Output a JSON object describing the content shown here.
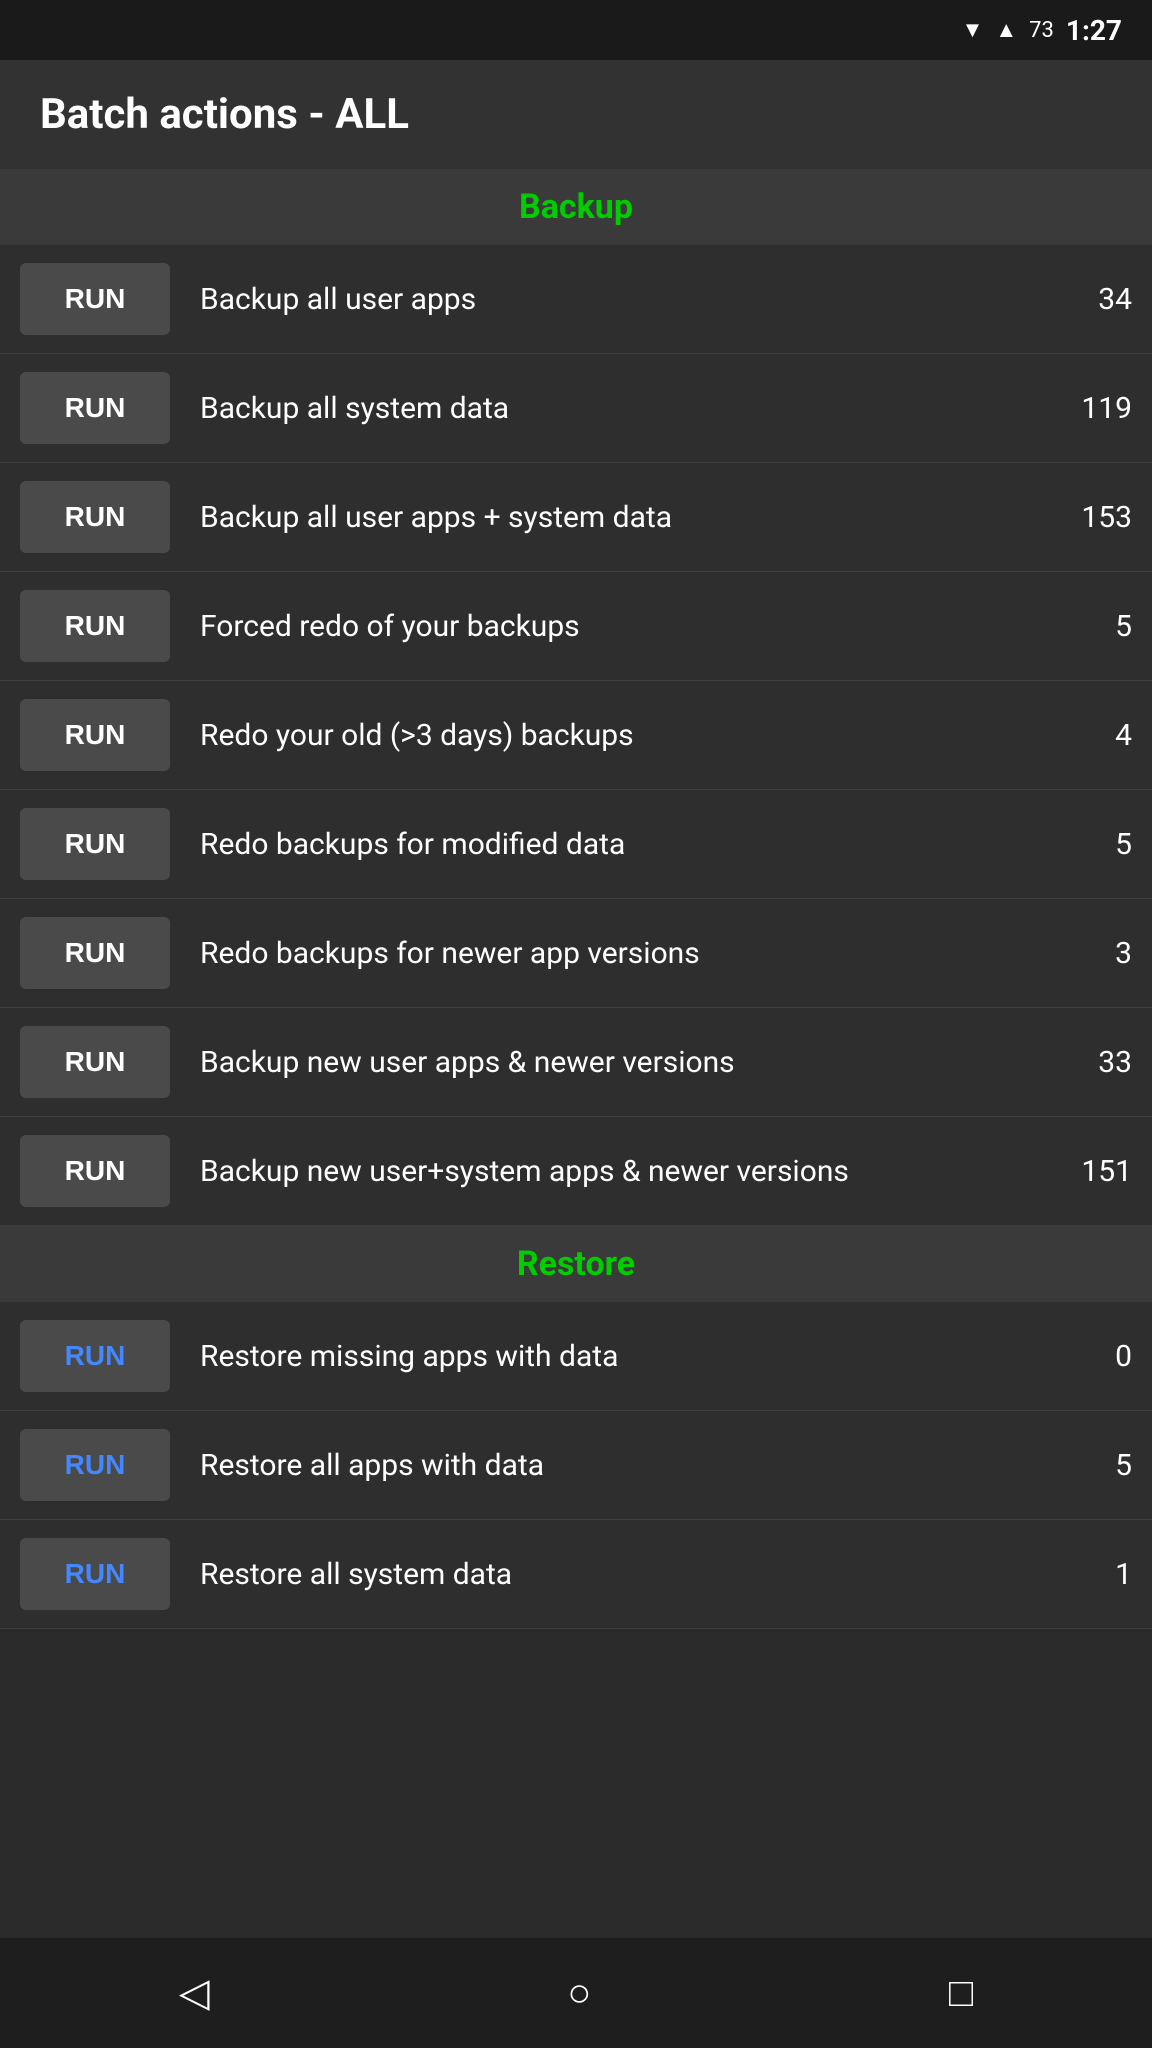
{
  "statusBar": {
    "time": "1:27",
    "batteryLevel": "73"
  },
  "header": {
    "title": "Batch actions - ALL"
  },
  "sections": [
    {
      "id": "backup",
      "label": "Backup",
      "color": "green",
      "items": [
        {
          "id": "backup-user-apps",
          "label": "Backup all user apps",
          "count": "34",
          "buttonColor": "default"
        },
        {
          "id": "backup-system-data",
          "label": "Backup all system data",
          "count": "119",
          "buttonColor": "default"
        },
        {
          "id": "backup-user-system",
          "label": "Backup all user apps + system data",
          "count": "153",
          "buttonColor": "default"
        },
        {
          "id": "forced-redo",
          "label": "Forced redo of your backups",
          "count": "5",
          "buttonColor": "default"
        },
        {
          "id": "redo-old",
          "label": "Redo your old (>3 days) backups",
          "count": "4",
          "buttonColor": "default"
        },
        {
          "id": "redo-modified",
          "label": "Redo backups for modified data",
          "count": "5",
          "buttonColor": "default"
        },
        {
          "id": "redo-newer-versions",
          "label": "Redo backups for newer app versions",
          "count": "3",
          "buttonColor": "default"
        },
        {
          "id": "backup-new-user-apps",
          "label": "Backup new user apps & newer versions",
          "count": "33",
          "buttonColor": "default"
        },
        {
          "id": "backup-new-user-system",
          "label": "Backup new user+system apps & newer versions",
          "count": "151",
          "buttonColor": "default"
        }
      ]
    },
    {
      "id": "restore",
      "label": "Restore",
      "color": "green",
      "items": [
        {
          "id": "restore-missing",
          "label": "Restore missing apps with data",
          "count": "0",
          "buttonColor": "blue"
        },
        {
          "id": "restore-all-apps",
          "label": "Restore all apps with data",
          "count": "5",
          "buttonColor": "blue"
        },
        {
          "id": "restore-system-data",
          "label": "Restore all system data",
          "count": "1",
          "buttonColor": "blue"
        }
      ]
    }
  ],
  "runLabel": "RUN",
  "navBar": {
    "backLabel": "◁",
    "homeLabel": "○",
    "recentLabel": "□"
  }
}
